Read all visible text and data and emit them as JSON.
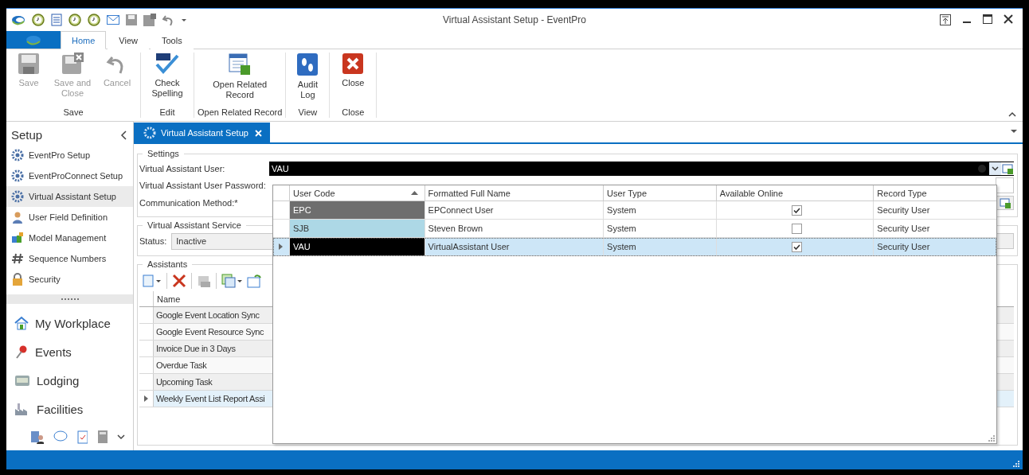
{
  "window": {
    "title": "Virtual Assistant Setup - EventPro"
  },
  "ribbon": {
    "tabs": [
      {
        "label": "Home",
        "selected": true
      },
      {
        "label": "View",
        "selected": false
      },
      {
        "label": "Tools",
        "selected": false
      }
    ],
    "groups": [
      {
        "label": "Save",
        "buttons": [
          {
            "label": "Save",
            "disabled": true
          },
          {
            "label": "Save and Close",
            "disabled": true
          },
          {
            "label": "Cancel",
            "disabled": true
          }
        ]
      },
      {
        "label": "Edit",
        "buttons": [
          {
            "label": "Check Spelling",
            "disabled": false
          }
        ]
      },
      {
        "label": "Open Related Record",
        "buttons": [
          {
            "label": "Open Related Record",
            "disabled": false
          }
        ]
      },
      {
        "label": "View",
        "buttons": [
          {
            "label": "Audit Log",
            "disabled": false
          }
        ]
      },
      {
        "label": "Close",
        "buttons": [
          {
            "label": "Close",
            "disabled": false
          }
        ]
      }
    ]
  },
  "sidebar": {
    "title": "Setup",
    "items": [
      {
        "label": "EventPro Setup",
        "selected": false
      },
      {
        "label": "EventProConnect Setup",
        "selected": false
      },
      {
        "label": "Virtual Assistant Setup",
        "selected": true
      },
      {
        "label": "User Field Definition",
        "selected": false
      },
      {
        "label": "Model Management",
        "selected": false
      },
      {
        "label": "Sequence Numbers",
        "selected": false
      },
      {
        "label": "Security",
        "selected": false
      }
    ],
    "nav": [
      {
        "label": "My Workplace"
      },
      {
        "label": "Events"
      },
      {
        "label": "Lodging"
      },
      {
        "label": "Facilities"
      }
    ]
  },
  "document_tab": {
    "label": "Virtual Assistant Setup",
    "selected": true
  },
  "settings": {
    "legend": "Settings",
    "fields": [
      {
        "label": "Virtual Assistant User:"
      },
      {
        "label": "Virtual Assistant User Password:"
      },
      {
        "label": "Communication Method:*"
      }
    ],
    "user_value": "VAU"
  },
  "lookup": {
    "columns": [
      {
        "label": "User Code",
        "sorted": true
      },
      {
        "label": "Formatted Full Name",
        "sorted": false
      },
      {
        "label": "User Type",
        "sorted": false
      },
      {
        "label": "Available Online",
        "sorted": false
      },
      {
        "label": "Record Type",
        "sorted": false
      }
    ],
    "rows": [
      {
        "user_code": "EPC",
        "formatted_full_name": "EPConnect User",
        "user_type": "System",
        "available_online": true,
        "record_type": "Security User",
        "color": "#6e6e6e",
        "selected": false
      },
      {
        "user_code": "SJB",
        "formatted_full_name": "Steven Brown",
        "user_type": "System",
        "available_online": false,
        "record_type": "Security User",
        "color": "#add8e6",
        "selected": false
      },
      {
        "user_code": "VAU",
        "formatted_full_name": "VirtualAssistant User",
        "user_type": "System",
        "available_online": true,
        "record_type": "Security User",
        "color": "#000000",
        "selected": true
      }
    ]
  },
  "service": {
    "legend": "Virtual Assistant Service",
    "status_label": "Status:",
    "status_value": "Inactive"
  },
  "assistants": {
    "legend": "Assistants",
    "column": "Name",
    "rows": [
      {
        "name": "Google Event Location Sync",
        "selected": false
      },
      {
        "name": "Google Event Resource Sync",
        "selected": false
      },
      {
        "name": "Invoice Due in 3 Days",
        "selected": false
      },
      {
        "name": "Overdue Task",
        "selected": false
      },
      {
        "name": "Upcoming Task",
        "selected": false
      },
      {
        "name": "Weekly Event List Report Assi",
        "selected": true
      }
    ]
  }
}
